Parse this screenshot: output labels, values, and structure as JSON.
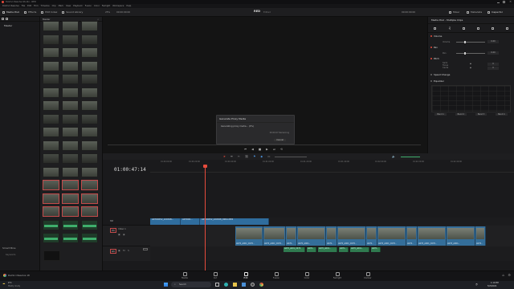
{
  "app": {
    "title": "DaVinci Resolve Studio - RED",
    "project_name": "RED",
    "project_status": "Edited"
  },
  "menu": [
    "DaVinci Resolve",
    "File",
    "Edit",
    "Trim",
    "Timeline",
    "Clip",
    "Mark",
    "View",
    "Playback",
    "Fusion",
    "Color",
    "Fairlight",
    "Workspace",
    "Help"
  ],
  "toolbar": {
    "media_pool": "Media Pool",
    "effects": "Effects",
    "edit_index": "Edit Index",
    "sound_library": "Sound Library",
    "mixer": "Mixer",
    "metadata": "Metadata",
    "inspector": "Inspector",
    "zoom": "25%",
    "source_tc": "00:00:00:00",
    "record_tc": "00:00:00:00"
  },
  "bins": {
    "master": "Master",
    "smart_bins": "Smart Bins",
    "keywords": "Keywords"
  },
  "pool": {
    "sort_label": "Master"
  },
  "dialog": {
    "title": "Generate Proxy Media",
    "message": "Generating proxy media... (0%)",
    "time_remaining": "00:00:07 Remaining",
    "cancel": "Cancel"
  },
  "inspector": {
    "title": "Media Pool - Multiple Clips",
    "tabs": [
      "Video",
      "Audio",
      "Effects",
      "Transition",
      "Image",
      "File"
    ],
    "active_tab": "Audio",
    "sections": {
      "volume": "Volume",
      "volume_param": "Volume",
      "volume_val": "0.00",
      "pan": "Pan",
      "pan_param": "Pan",
      "pan_val": "0.00",
      "pitch": "Pitch",
      "semitones": "Semi Tones",
      "semitones_val": "0",
      "cents": "Cents",
      "cents_val": "0",
      "speed_change": "Speed Change",
      "equalizer": "Equalizer",
      "bands": [
        "Band 1",
        "Band 2",
        "Band 3",
        "Band 4"
      ]
    }
  },
  "timeline": {
    "timecode": "01:00:47:14",
    "ruler": [
      "01:00:00:00",
      "01:00:20:00",
      "01:00:40:00",
      "01:01:00:00",
      "01:01:20:00",
      "01:01:40:00",
      "01:02:00:00",
      "01:02:20:00",
      "01:02:40:00"
    ],
    "tracks": {
      "v2": "V2",
      "v1": "V1",
      "v1_name": "Video 1",
      "a1": "A1"
    },
    "v2_clips": [
      "A070C052_220328...",
      "A070C0...",
      "A070C052_220328_R90A.MP4"
    ],
    "v1_clips": [
      "A070_A001_C070..",
      "A070_A001_C070..",
      "A070..",
      "A070_A001..",
      "A070..",
      "A070_A001_C070..",
      "A070..",
      "A070_A001_C070..",
      "A070..",
      "A070_A001_C070..",
      "A070_A001..",
      "A070.."
    ],
    "a1_clips": [
      "A070_A001_C070",
      "A070..",
      "A070_A001..",
      "A070..",
      "A070_A001..",
      "A070.."
    ]
  },
  "pages": [
    {
      "label": "Media",
      "icon": "media-icon"
    },
    {
      "label": "Cut",
      "icon": "cut-icon"
    },
    {
      "label": "Edit",
      "icon": "edit-icon"
    },
    {
      "label": "Fusion",
      "icon": "fusion-icon"
    },
    {
      "label": "Color",
      "icon": "color-icon"
    },
    {
      "label": "Fairlight",
      "icon": "fairlight-icon"
    },
    {
      "label": "Deliver",
      "icon": "deliver-icon"
    }
  ],
  "active_page": "Edit",
  "bottom": {
    "app_name": "DaVinci Resolve 18"
  },
  "taskbar": {
    "weather_temp": "9°C",
    "weather_text": "Mostly cloudy",
    "search": "Search",
    "time": "1:10 PM",
    "date": "5/29/2024"
  },
  "colors": {
    "accent": "#e64b3c",
    "clip_video": "#346e9a",
    "clip_audio": "#2f7a4f"
  }
}
